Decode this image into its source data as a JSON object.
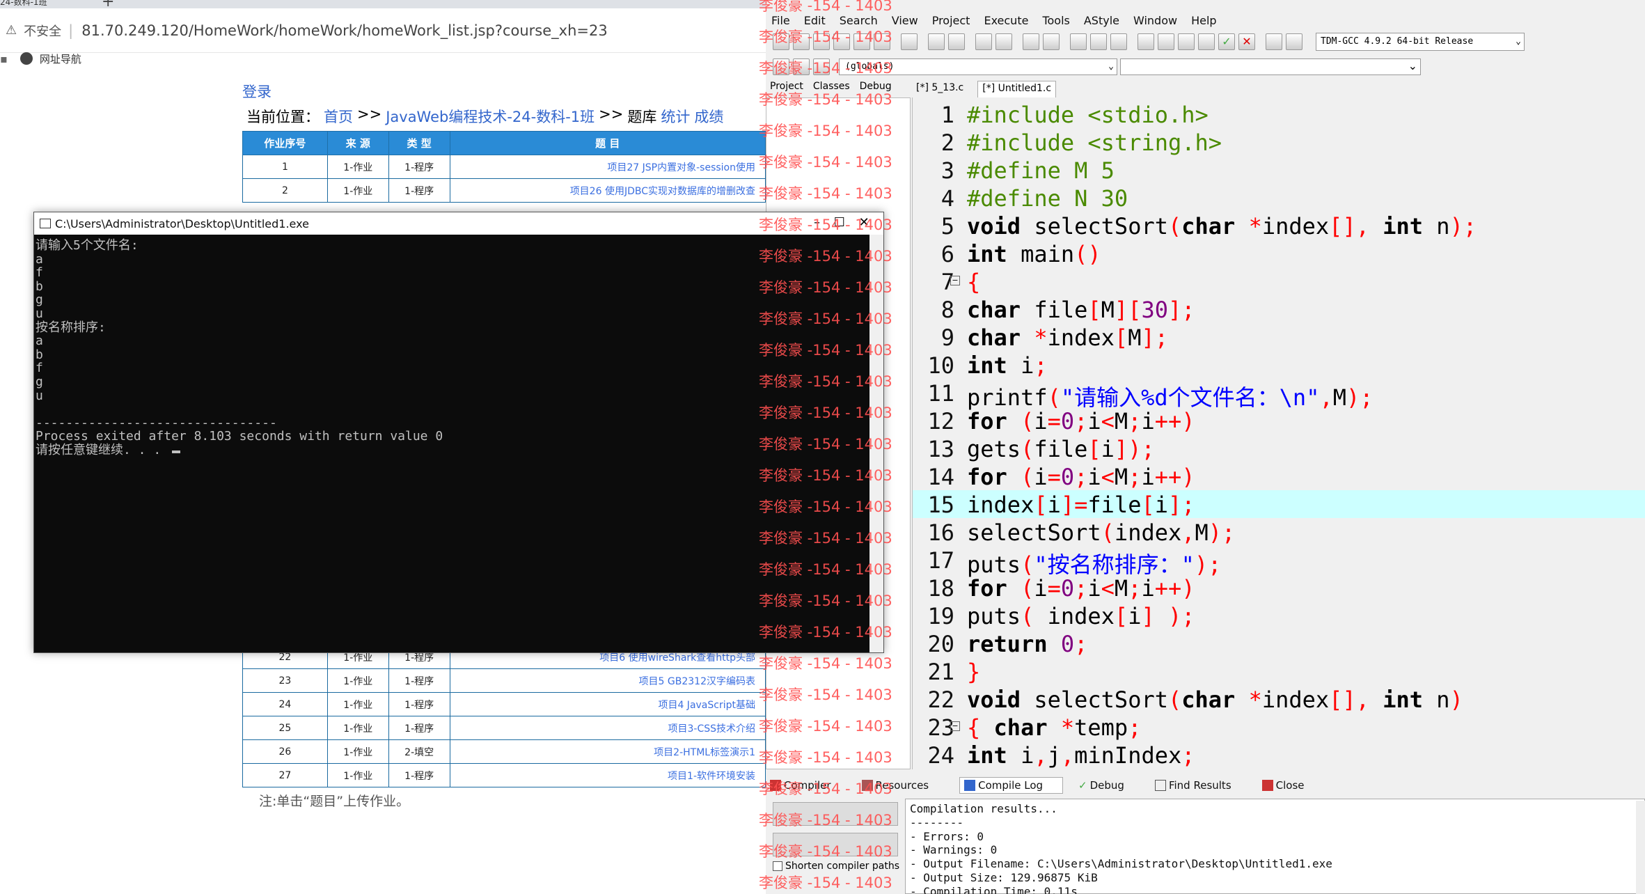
{
  "browser": {
    "tab_title": "24-数科-1班",
    "security_label": "不安全",
    "url": "81.70.249.120/HomeWork/homeWork/homeWork_list.jsp?course_xh=23",
    "bookmark": "网址导航",
    "login_link": "登录",
    "breadcrumb_prefix": "当前位置：",
    "breadcrumb_home": "首页",
    "breadcrumb_sep1": ">>",
    "breadcrumb_course": "JavaWeb编程技术-24-数科-1班",
    "breadcrumb_sep2": ">>",
    "breadcrumb_bank": "题库",
    "breadcrumb_stats": "统计",
    "breadcrumb_scores": "成绩",
    "table_headers": [
      "作业序号",
      "来 源",
      "类 型",
      "题 目"
    ],
    "rows_top": [
      {
        "no": "1",
        "src": "1-作业",
        "type": "1-程序",
        "title": "项目27 JSP内置对象-session使用"
      },
      {
        "no": "2",
        "src": "1-作业",
        "type": "1-程序",
        "title": "项目26 使用JDBC实现对数据库的增删改查"
      }
    ],
    "rows_bottom": [
      {
        "no": "22",
        "src": "1-作业",
        "type": "1-程序",
        "title": "项目6 使用wireShark查看http头部"
      },
      {
        "no": "23",
        "src": "1-作业",
        "type": "1-程序",
        "title": "项目5 GB2312汉字编码表"
      },
      {
        "no": "24",
        "src": "1-作业",
        "type": "1-程序",
        "title": "项目4 JavaScript基础"
      },
      {
        "no": "25",
        "src": "1-作业",
        "type": "1-程序",
        "title": "项目3-CSS技术介绍"
      },
      {
        "no": "26",
        "src": "1-作业",
        "type": "2-填空",
        "title": "项目2-HTML标签演示1"
      },
      {
        "no": "27",
        "src": "1-作业",
        "type": "1-程序",
        "title": "项目1-软件环境安装"
      }
    ],
    "note": "注:单击“题目”上传作业。"
  },
  "console": {
    "title": "C:\\Users\\Administrator\\Desktop\\Untitled1.exe",
    "output": "请输入5个文件名:\na\nf\nb\ng\nu\n按名称排序:\na\nb\nf\ng\nu\n\n--------------------------------\nProcess exited after 8.103 seconds with return value 0\n请按任意键继续. . ."
  },
  "ide": {
    "menu": [
      "File",
      "Edit",
      "Search",
      "View",
      "Project",
      "Execute",
      "Tools",
      "AStyle",
      "Window",
      "Help"
    ],
    "compiler_select": "TDM-GCC 4.9.2 64-bit Release",
    "globals_select": "(globals)",
    "left_tabs": [
      "Project",
      "Classes",
      "Debug"
    ],
    "editor_tabs": [
      "[*] 5_13.c",
      "[*] Untitled1.c"
    ],
    "line_numbers": [
      "1",
      "2",
      "3",
      "4",
      "5",
      "6",
      "7",
      "8",
      "9",
      "10",
      "11",
      "12",
      "13",
      "14",
      "15",
      "16",
      "17",
      "18",
      "19",
      "20",
      "21",
      "22",
      "23",
      "24"
    ],
    "bottom_tabs": [
      "Compiler",
      "Resources",
      "Compile Log",
      "Debug",
      "Find Results",
      "Close"
    ],
    "shorten_paths": "Shorten compiler paths",
    "compile_log": "Compilation results...\n--------\n- Errors: 0\n- Warnings: 0\n- Output Filename: C:\\Users\\Administrator\\Desktop\\Untitled1.exe\n- Output Size: 129.96875 KiB\n- Compilation Time: 0.11s"
  },
  "watermark": "李俊豪 -154 - 1403"
}
